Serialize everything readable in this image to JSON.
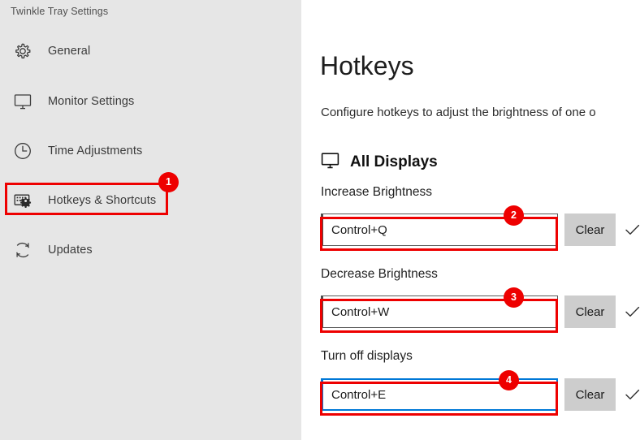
{
  "window": {
    "title": "Twinkle Tray Settings"
  },
  "theme": {
    "sidebar_bg": "#e6e6e6",
    "main_bg": "#ffffff",
    "annotation_red": "#ee0000",
    "focus_blue": "#0078d7",
    "button_gray": "#cdcdcd",
    "text_dark": "#1d1d1d"
  },
  "sidebar": {
    "items": [
      {
        "label": "General",
        "icon": "gear-icon",
        "selected": false
      },
      {
        "label": "Monitor Settings",
        "icon": "monitor-icon",
        "selected": false
      },
      {
        "label": "Time Adjustments",
        "icon": "clock-icon",
        "selected": false
      },
      {
        "label": "Hotkeys & Shortcuts",
        "icon": "keyboard-gear-icon",
        "selected": true
      },
      {
        "label": "Updates",
        "icon": "refresh-icon",
        "selected": false
      }
    ]
  },
  "main": {
    "title": "Hotkeys",
    "description": "Configure hotkeys to adjust the brightness of one o",
    "section": {
      "icon": "monitor-icon",
      "label": "All Displays"
    },
    "hotkeys": [
      {
        "label": "Increase Brightness",
        "value": "Control+Q",
        "placeholder": "",
        "clear_label": "Clear",
        "status_icon": "check-icon",
        "focused": false
      },
      {
        "label": "Decrease Brightness",
        "value": "Control+W",
        "placeholder": "",
        "clear_label": "Clear",
        "status_icon": "check-icon",
        "focused": false
      },
      {
        "label": "Turn off displays",
        "value": "Control+E",
        "placeholder": "",
        "clear_label": "Clear",
        "status_icon": "check-icon",
        "focused": true
      }
    ]
  },
  "annotations": [
    {
      "number": "1",
      "target": "sidebar-item-hotkeys-shortcuts"
    },
    {
      "number": "2",
      "target": "hotkey-input-increase-brightness"
    },
    {
      "number": "3",
      "target": "hotkey-input-decrease-brightness"
    },
    {
      "number": "4",
      "target": "hotkey-input-turn-off-displays"
    }
  ]
}
